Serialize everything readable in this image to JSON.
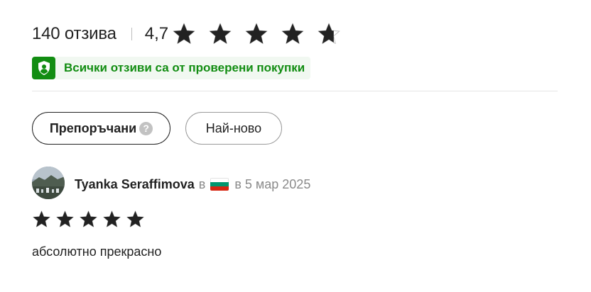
{
  "summary": {
    "review_count_text": "140 отзива",
    "average_rating": "4,7",
    "rating_value": 4.7,
    "star_count": 5,
    "star_color": "#222222"
  },
  "verified_banner": {
    "text": "Всички отзиви са от проверени покупки",
    "icon": "shield-person-icon",
    "accent_color": "#128d12",
    "background_color": "#f1f8f1"
  },
  "sort": {
    "recommended_label": "Препоръчани",
    "newest_label": "Най-ново",
    "help_glyph": "?"
  },
  "reviews": [
    {
      "author": "Tyanka Seraffimova",
      "in_word": "в",
      "country_flag": "bulgaria-flag-icon",
      "date_text": "в 5 мар 2025",
      "rating": 5,
      "text": "абсолютно прекрасно"
    }
  ]
}
